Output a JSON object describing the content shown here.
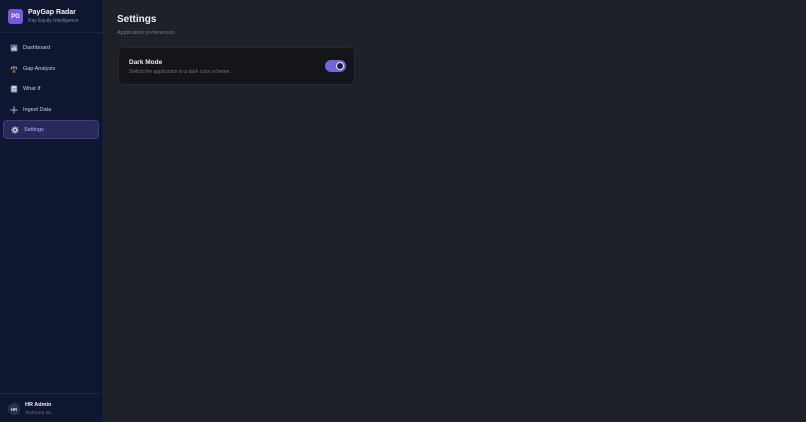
{
  "brand": {
    "logo": "PG",
    "name": "PayGap Radar",
    "subtitle": "Pay Equity Intelligence"
  },
  "nav": {
    "items": [
      {
        "label": "Dashboard",
        "icon": "chart-icon",
        "active": false
      },
      {
        "label": "Gap Analysis",
        "icon": "scale-icon",
        "active": false
      },
      {
        "label": "What If",
        "icon": "calculator-icon",
        "active": false
      },
      {
        "label": "Ingest Data",
        "icon": "plus-icon",
        "active": false
      },
      {
        "label": "Settings",
        "icon": "gear-icon",
        "active": true
      }
    ]
  },
  "user": {
    "initials": "HR",
    "name": "HR Admin",
    "org": "TechCorp Inc."
  },
  "page": {
    "title": "Settings",
    "subtitle": "Application preferences."
  },
  "settings": {
    "dark_mode": {
      "title": "Dark Mode",
      "description": "Switch the application to a dark color scheme.",
      "enabled": true
    }
  },
  "colors": {
    "accent": "#6f66e0",
    "sidebar_bg": "#0f1630",
    "main_bg": "#1f2128",
    "card_bg": "#141519"
  }
}
